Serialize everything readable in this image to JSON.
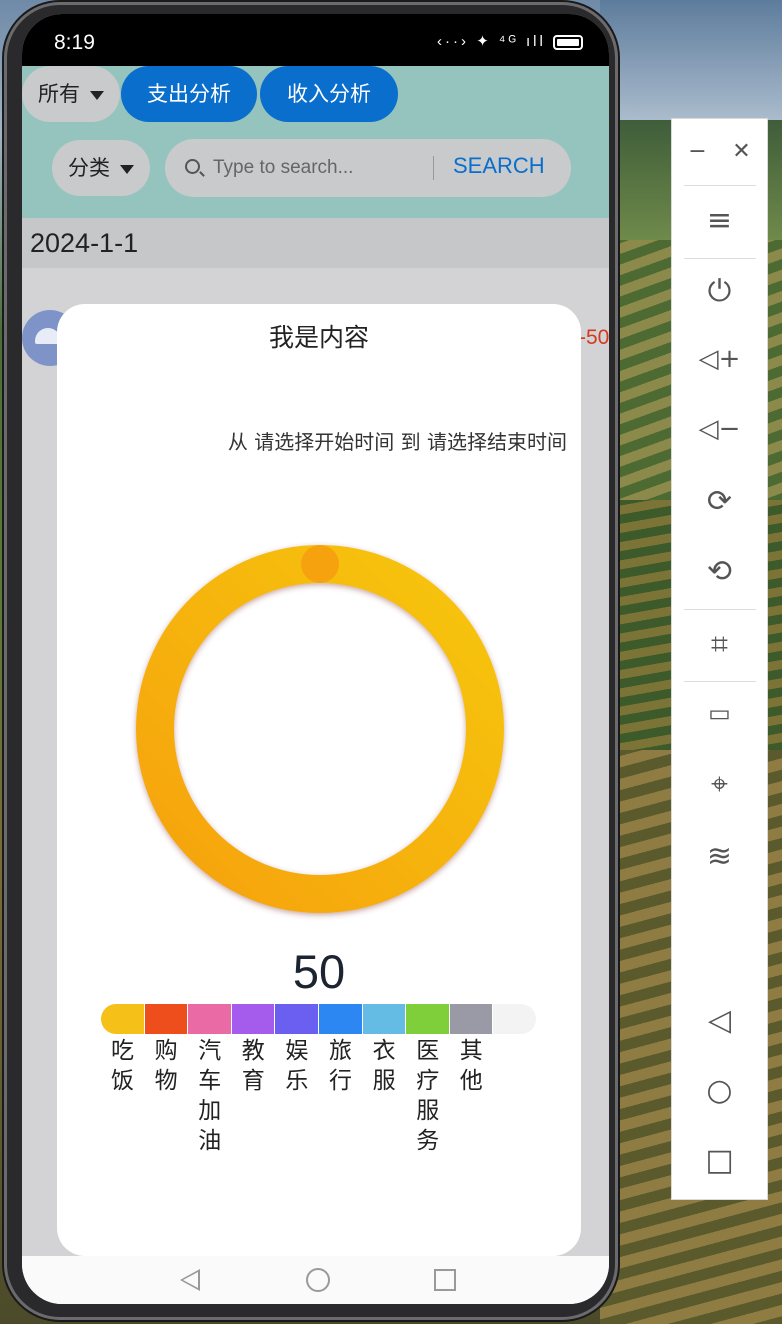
{
  "status_bar": {
    "time": "8:19",
    "icons": "‹··› ✦ ⁴ᴳ ıll"
  },
  "filters": {
    "scope_label": "所有",
    "expense_button": "支出分析",
    "income_button": "收入分析",
    "category_label": "分类",
    "search_placeholder": "Type to search...",
    "search_button": "SEARCH"
  },
  "list": {
    "date": "2024-1-1",
    "first_amount": "-50"
  },
  "modal": {
    "title": "我是内容",
    "range_from": "从",
    "range_start": "请选择开始时间",
    "range_to": "到",
    "range_end": "请选择结束时间",
    "total": "50"
  },
  "chart_data": {
    "type": "pie",
    "variant": "donut",
    "total": 50,
    "slices": [
      {
        "name": "吃饭",
        "value": 50,
        "color": "#f6b80a"
      }
    ],
    "legend": [
      {
        "label": "吃饭",
        "color": "#f5c017"
      },
      {
        "label": "购物",
        "color": "#ee4e1c"
      },
      {
        "label": "汽车加油",
        "color": "#e96aa5"
      },
      {
        "label": "教育",
        "color": "#a55bec"
      },
      {
        "label": "娱乐",
        "color": "#6a5ff0"
      },
      {
        "label": "旅行",
        "color": "#2c87f2"
      },
      {
        "label": "衣服",
        "color": "#64bbe3"
      },
      {
        "label": "医疗服务",
        "color": "#7fcf3b"
      },
      {
        "label": "其他",
        "color": "#9a9aa6"
      },
      {
        "label": "",
        "color": "#f3f3f4"
      }
    ]
  },
  "emulator_panel": {
    "items": [
      "minimize",
      "close",
      "menu",
      "power",
      "volume-up",
      "volume-down",
      "rotate-right",
      "rotate-left",
      "screenshot-crop",
      "battery",
      "location",
      "wifi",
      "back",
      "home",
      "overview"
    ]
  }
}
